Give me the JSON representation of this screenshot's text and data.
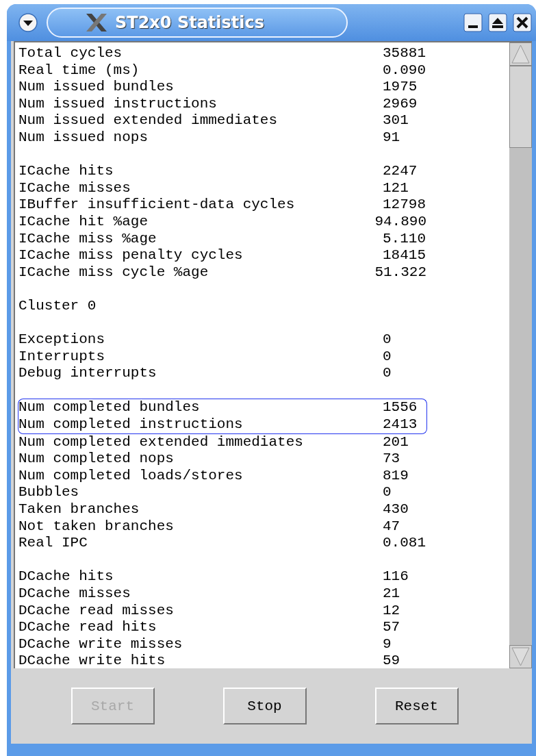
{
  "window": {
    "title": "ST2x0 Statistics"
  },
  "lines": [
    {
      "kind": "stat",
      "label": "Total cycles",
      "value": "35881",
      "highlighted": false
    },
    {
      "kind": "stat",
      "label": "Real time (ms)",
      "value": "0.090",
      "highlighted": false
    },
    {
      "kind": "stat",
      "label": "Num issued bundles",
      "value": "1975",
      "highlighted": false
    },
    {
      "kind": "stat",
      "label": "Num issued instructions",
      "value": "2969",
      "highlighted": false
    },
    {
      "kind": "stat",
      "label": "Num issued extended immediates",
      "value": "301",
      "highlighted": false
    },
    {
      "kind": "stat",
      "label": "Num issued nops",
      "value": "91",
      "highlighted": false
    },
    {
      "kind": "blank"
    },
    {
      "kind": "stat",
      "label": "ICache hits",
      "value": "2247",
      "highlighted": false
    },
    {
      "kind": "stat",
      "label": "ICache misses",
      "value": "121",
      "highlighted": false
    },
    {
      "kind": "stat",
      "label": "IBuffer insufficient-data cycles",
      "value": "12798",
      "highlighted": false
    },
    {
      "kind": "stat",
      "label": "ICache hit %age",
      "value": "94.890",
      "highlighted": false
    },
    {
      "kind": "stat",
      "label": "ICache miss %age",
      "value": "5.110",
      "highlighted": false
    },
    {
      "kind": "stat",
      "label": "ICache miss penalty cycles",
      "value": "18415",
      "highlighted": false
    },
    {
      "kind": "stat",
      "label": "ICache miss cycle %age",
      "value": "51.322",
      "highlighted": false
    },
    {
      "kind": "blank"
    },
    {
      "kind": "heading",
      "label": "Cluster 0"
    },
    {
      "kind": "blank"
    },
    {
      "kind": "stat",
      "label": "Exceptions",
      "value": "0",
      "highlighted": false
    },
    {
      "kind": "stat",
      "label": "Interrupts",
      "value": "0",
      "highlighted": false
    },
    {
      "kind": "stat",
      "label": "Debug interrupts",
      "value": "0",
      "highlighted": false
    },
    {
      "kind": "blank"
    },
    {
      "kind": "stat",
      "label": "Num completed bundles",
      "value": "1556",
      "highlighted": true
    },
    {
      "kind": "stat",
      "label": "Num completed instructions",
      "value": "2413",
      "highlighted": true
    },
    {
      "kind": "stat",
      "label": "Num completed extended immediates",
      "value": "201",
      "highlighted": false
    },
    {
      "kind": "stat",
      "label": "Num completed nops",
      "value": "73",
      "highlighted": false
    },
    {
      "kind": "stat",
      "label": "Num completed loads/stores",
      "value": "819",
      "highlighted": false
    },
    {
      "kind": "stat",
      "label": "Bubbles",
      "value": "0",
      "highlighted": false
    },
    {
      "kind": "stat",
      "label": "Taken branches",
      "value": "430",
      "highlighted": false
    },
    {
      "kind": "stat",
      "label": "Not taken branches",
      "value": "47",
      "highlighted": false
    },
    {
      "kind": "stat",
      "label": "Real IPC",
      "value": "0.081",
      "highlighted": false
    },
    {
      "kind": "blank"
    },
    {
      "kind": "stat",
      "label": "DCache hits",
      "value": "116",
      "highlighted": false
    },
    {
      "kind": "stat",
      "label": "DCache misses",
      "value": "21",
      "highlighted": false
    },
    {
      "kind": "stat",
      "label": "DCache read misses",
      "value": "12",
      "highlighted": false
    },
    {
      "kind": "stat",
      "label": "DCache read hits",
      "value": "57",
      "highlighted": false
    },
    {
      "kind": "stat",
      "label": "DCache write misses",
      "value": "9",
      "highlighted": false
    },
    {
      "kind": "stat",
      "label": "DCache write hits",
      "value": "59",
      "highlighted": false
    }
  ],
  "buttons": [
    {
      "label": "Start",
      "disabled": true
    },
    {
      "label": "Stop",
      "disabled": false
    },
    {
      "label": "Reset",
      "disabled": false
    }
  ]
}
